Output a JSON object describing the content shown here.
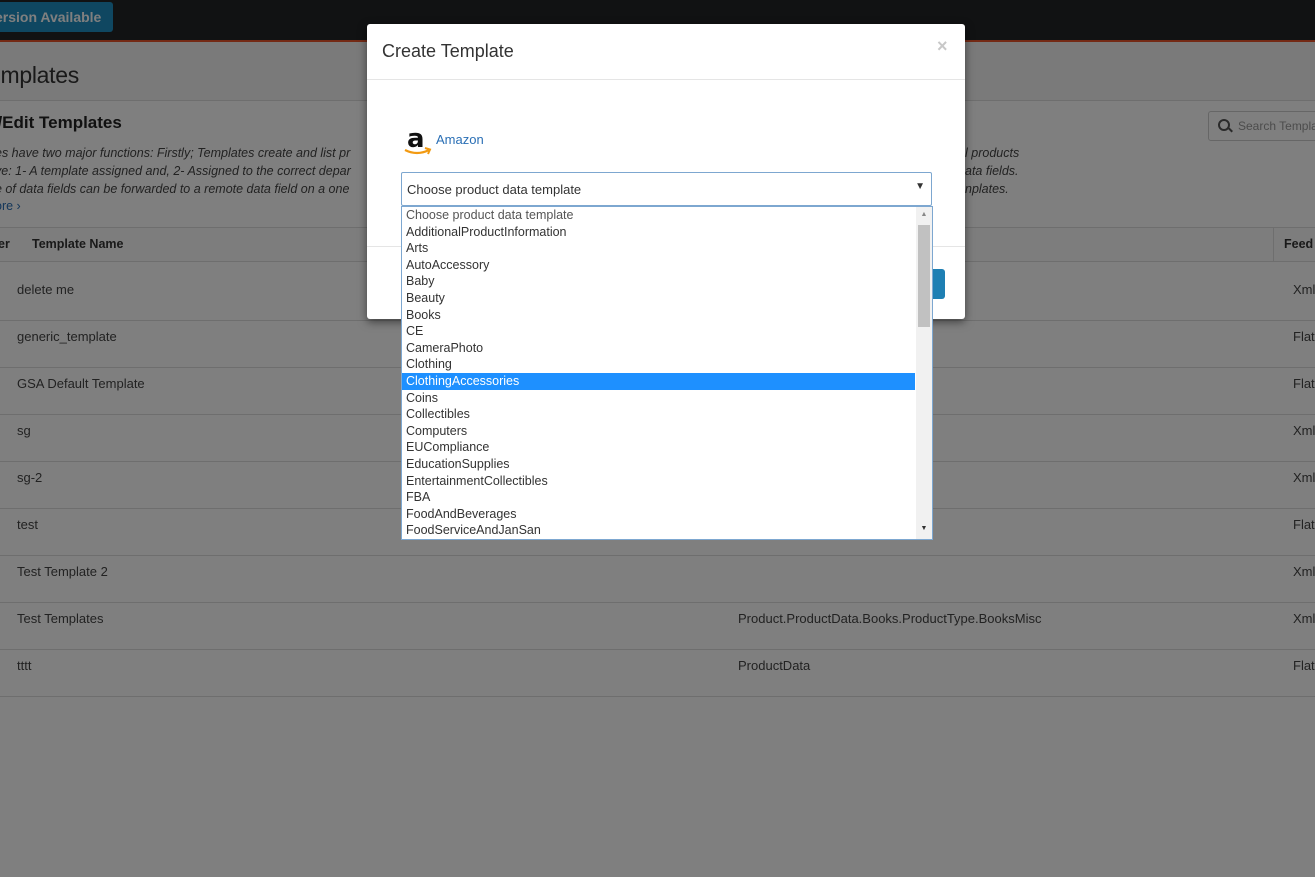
{
  "topbar": {
    "version_button": "ersion Available"
  },
  "page": {
    "title": "emplates"
  },
  "section": {
    "title": "e/Edit Templates",
    "description_lines": [
      "es have two major functions: Firstly; Templates create and list pr",
      "ve: 1- A template assigned and, 2- Assigned to the correct depar",
      "e of data fields can be forwarded to a remote data field on a one"
    ],
    "description_right_lines": [
      "l products",
      "ata fields.",
      "nplates."
    ],
    "more_link": "ore ›"
  },
  "search": {
    "placeholder": "Search Templa"
  },
  "table": {
    "headers": {
      "col0": "er",
      "name": "Template Name",
      "feed": "Feed"
    },
    "rows": [
      {
        "name": "delete me",
        "path": "",
        "feed": "Xml"
      },
      {
        "name": "generic_template",
        "path": "",
        "feed": "Flat"
      },
      {
        "name": "GSA Default Template",
        "path": "",
        "feed": "Flat"
      },
      {
        "name": "sg",
        "path": "",
        "feed": "Xml"
      },
      {
        "name": "sg-2",
        "path": "",
        "feed": "Xml"
      },
      {
        "name": "test",
        "path": "",
        "feed": "Flat"
      },
      {
        "name": "Test Template 2",
        "path": "",
        "feed": "Xml"
      },
      {
        "name": "Test Templates",
        "path": "Product.ProductData.Books.ProductType.BooksMisc",
        "feed": "Xml"
      },
      {
        "name": "tttt",
        "path": "ProductData",
        "feed": "Flat"
      }
    ]
  },
  "modal": {
    "title": "Create Template",
    "close": "×",
    "marketplace": {
      "logo_letter": "a",
      "name": "Amazon"
    },
    "select": {
      "value": "Choose product data template",
      "caret": "▼",
      "options": [
        "Choose product data template",
        "AdditionalProductInformation",
        "Arts",
        "AutoAccessory",
        "Baby",
        "Beauty",
        "Books",
        "CE",
        "CameraPhoto",
        "Clothing",
        "ClothingAccessories",
        "Coins",
        "Collectibles",
        "Computers",
        "EUCompliance",
        "EducationSupplies",
        "EntertainmentCollectibles",
        "FBA",
        "FoodAndBeverages",
        "FoodServiceAndJanSan"
      ],
      "highlighted_index": 10
    }
  },
  "colors": {
    "accent": "#1e90ff",
    "topbar": "#222427",
    "brand_orange": "#e8542a",
    "link": "#2a6fb5"
  }
}
